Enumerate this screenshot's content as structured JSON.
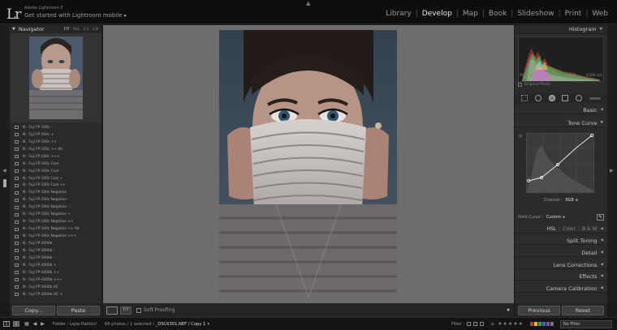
{
  "app": {
    "logo": "Lr",
    "title": "Adobe Lightroom 5",
    "subtitle": "Get started with Lightroom mobile",
    "subtitle_arrow": "▸"
  },
  "modules": [
    "Library",
    "Develop",
    "Map",
    "Book",
    "Slideshow",
    "Print",
    "Web"
  ],
  "active_module": "Develop",
  "navigator": {
    "title": "Navigator",
    "zooms": [
      "FIT",
      "FILL",
      "1:1",
      "1:8"
    ],
    "active_zoom": "FIT"
  },
  "presets": [
    "N - Fuji FP-100c - -",
    "N - Fuji FP-100c +",
    "N - Fuji FP-100c ++",
    "N - Fuji FP-100c ++ Alt",
    "N - Fuji FP-100c +++",
    "N - Fuji FP-100c Cool",
    "N - Fuji FP-100c Cool - -",
    "N - Fuji FP-100c Cool +",
    "N - Fuji FP-100c Cool ++",
    "N - Fuji FP-100c Negative",
    "N - Fuji FP-100c Negative -",
    "N - Fuji FP-100c Negative - -",
    "N - Fuji FP-100c Negative +",
    "N - Fuji FP-100c Negative ++",
    "N - Fuji FP-100c Negative ++ Alt",
    "N - Fuji FP-100c Negative +++",
    "N - Fuji FP-3000b",
    "N - Fuji FP-3000b -",
    "N - Fuji FP-3000b - -",
    "N - Fuji FP-3000b +",
    "N - Fuji FP-3000b ++",
    "N - Fuji FP-3000b +++",
    "N - Fuji FP-3000b HC",
    "N - Fuji FP-3000b HC +"
  ],
  "left_buttons": {
    "copy": "Copy...",
    "paste": "Paste"
  },
  "toolbar": {
    "soft_proofing": "Soft Proofing",
    "dropdown": "▼"
  },
  "right_panel": {
    "histogram_title": "Histogram",
    "histogram_info": [
      "ISO 200",
      "50 mm",
      "f / 1.8",
      "1/100 sec"
    ],
    "original_photo": "Original Photo",
    "basic": "Basic",
    "tone_curve": "Tone Curve",
    "channel_label": "Channel :",
    "channel_value": "RGB ≑",
    "point_curve_label": "Point Curve :",
    "point_curve_value": "Custom ≑",
    "hsl_tabs": [
      "HSL",
      "Color",
      "B & W"
    ],
    "sections": [
      "Split Toning",
      "Detail",
      "Lens Corrections",
      "Effects",
      "Camera Calibration"
    ],
    "previous_button": "Previous",
    "reset_button": "Reset"
  },
  "filmstrip": {
    "monitor_1": "1",
    "monitor_2": "2",
    "folder": "Folder : Lejla Halilovi",
    "count_prefix": "66 photos / 1 selected /",
    "filename": "_DSC6301.NEF / Copy 1",
    "caret": "▾",
    "filter_label": "Filter :",
    "filter_value": "No Filter",
    "label_colors": [
      "#d32f2f",
      "#e6c229",
      "#3fa63f",
      "#2f6fd3",
      "#8e44ad",
      "#777777"
    ]
  }
}
